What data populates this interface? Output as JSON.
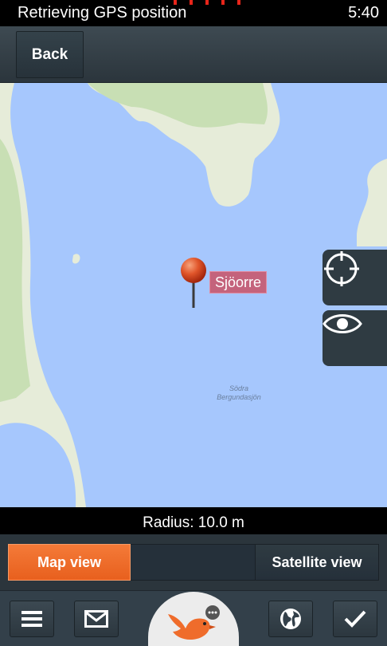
{
  "status_bar": {
    "title": "Retrieving GPS position",
    "time": "5:40"
  },
  "header": {
    "back_label": "Back"
  },
  "map": {
    "place_label": "Sjöorre",
    "water_label_line1": "Södra",
    "water_label_line2": "Bergundasjön",
    "colors": {
      "water": "#a6c7fd",
      "land": "#e6ecd9",
      "park": "#c8dfb4",
      "pin": "#d6451c"
    }
  },
  "map_controls": {
    "locate_icon": "crosshair-icon",
    "eye_icon": "eye-icon"
  },
  "radius_text": "Radius: 10.0 m",
  "view_tabs": {
    "map_label": "Map view",
    "satellite_label": "Satellite view",
    "active": "Map view",
    "accent": "#ef6c2b"
  },
  "bottom_bar": {
    "icons": [
      "menu-icon",
      "mail-icon",
      "bird-logo-icon",
      "globe-icon",
      "check-icon"
    ]
  }
}
